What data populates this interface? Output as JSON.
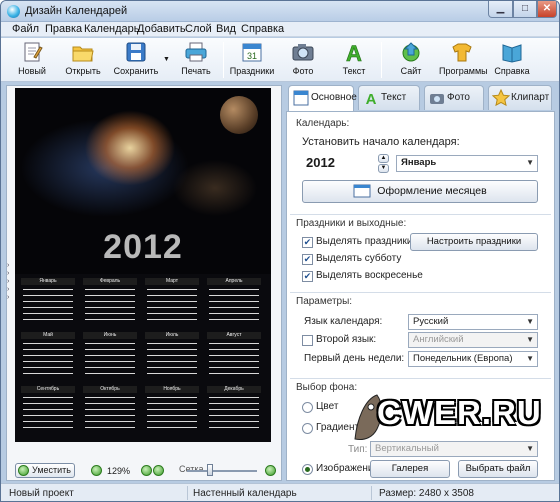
{
  "window": {
    "title": "Дизайн Календарей"
  },
  "menu": [
    "Файл",
    "Правка",
    "Календарь",
    "Добавить",
    "Слой",
    "Вид",
    "Справка"
  ],
  "toolbar": {
    "new": "Новый",
    "open": "Открыть",
    "save": "Сохранить",
    "print": "Печать",
    "holidays": "Праздники",
    "photo": "Фото",
    "text": "Текст",
    "site": "Сайт",
    "programs": "Программы",
    "help": "Справка"
  },
  "poster": {
    "year": "2012",
    "months": [
      "Январь",
      "Февраль",
      "Март",
      "Апрель",
      "Май",
      "Июнь",
      "Июль",
      "Август",
      "Сентябрь",
      "Октябрь",
      "Ноябрь",
      "Декабрь"
    ]
  },
  "left_footer": {
    "fit_button": "Уместить",
    "zoom": "129%",
    "slider_label": "Сетка"
  },
  "tabs": {
    "basic": "Основное",
    "text": "Текст",
    "photo": "Фото",
    "clipart": "Клипарт"
  },
  "calendar_group": {
    "title": "Календарь:",
    "start_label": "Установить начало календаря:",
    "year_value": "2012",
    "month_value": "Январь",
    "design_button": "Оформление месяцев"
  },
  "holidays_group": {
    "title": "Праздники и выходные:",
    "highlight_holidays": "Выделять праздники",
    "setup_holidays_button": "Настроить праздники",
    "highlight_saturday": "Выделять субботу",
    "highlight_sunday": "Выделять воскресенье"
  },
  "params_group": {
    "title": "Параметры:",
    "language_label": "Язык календаря:",
    "language_value": "Русский",
    "second_language_label": "Второй язык:",
    "second_language_value": "Английский",
    "first_day_label": "Первый день недели:",
    "first_day_value": "Понедельник (Европа)"
  },
  "background_group": {
    "title": "Выбор фона:",
    "color": "Цвет",
    "gradient": "Градиент",
    "type_label": "Тип:",
    "type_value": "Вертикальный",
    "image": "Изображение",
    "gallery_button": "Галерея",
    "choose_file_button": "Выбрать файл"
  },
  "watermark": "CWER.RU",
  "status": {
    "project": "Новый проект",
    "type": "Настенный календарь",
    "size": "Размер: 2480 x 3508"
  },
  "colors": {
    "accent": "#3b9c2a",
    "window_frame": "#b7cbe2",
    "close": "#c7422a"
  }
}
